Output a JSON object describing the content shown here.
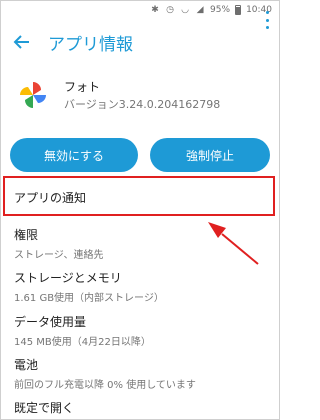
{
  "status_bar": {
    "battery_percent": "95%",
    "time": "10:40"
  },
  "app_bar": {
    "title": "アプリ情報"
  },
  "app": {
    "name": "フォト",
    "version": "バージョン3.24.0.204162798"
  },
  "buttons": {
    "disable": "無効にする",
    "force_stop": "強制停止"
  },
  "list": [
    {
      "title": "アプリの通知",
      "subtitle": ""
    },
    {
      "title": "権限",
      "subtitle": "ストレージ、連絡先"
    },
    {
      "title": "ストレージとメモリ",
      "subtitle": "1.61 GB使用（内部ストレージ）"
    },
    {
      "title": "データ使用量",
      "subtitle": "145 MB使用（4月22日以降）"
    },
    {
      "title": "電池",
      "subtitle": "前回のフル充電以降 0% 使用しています"
    },
    {
      "title": "既定で開く",
      "subtitle": ""
    }
  ],
  "colors": {
    "accent": "#1e9ad6",
    "highlight": "#e02020"
  }
}
